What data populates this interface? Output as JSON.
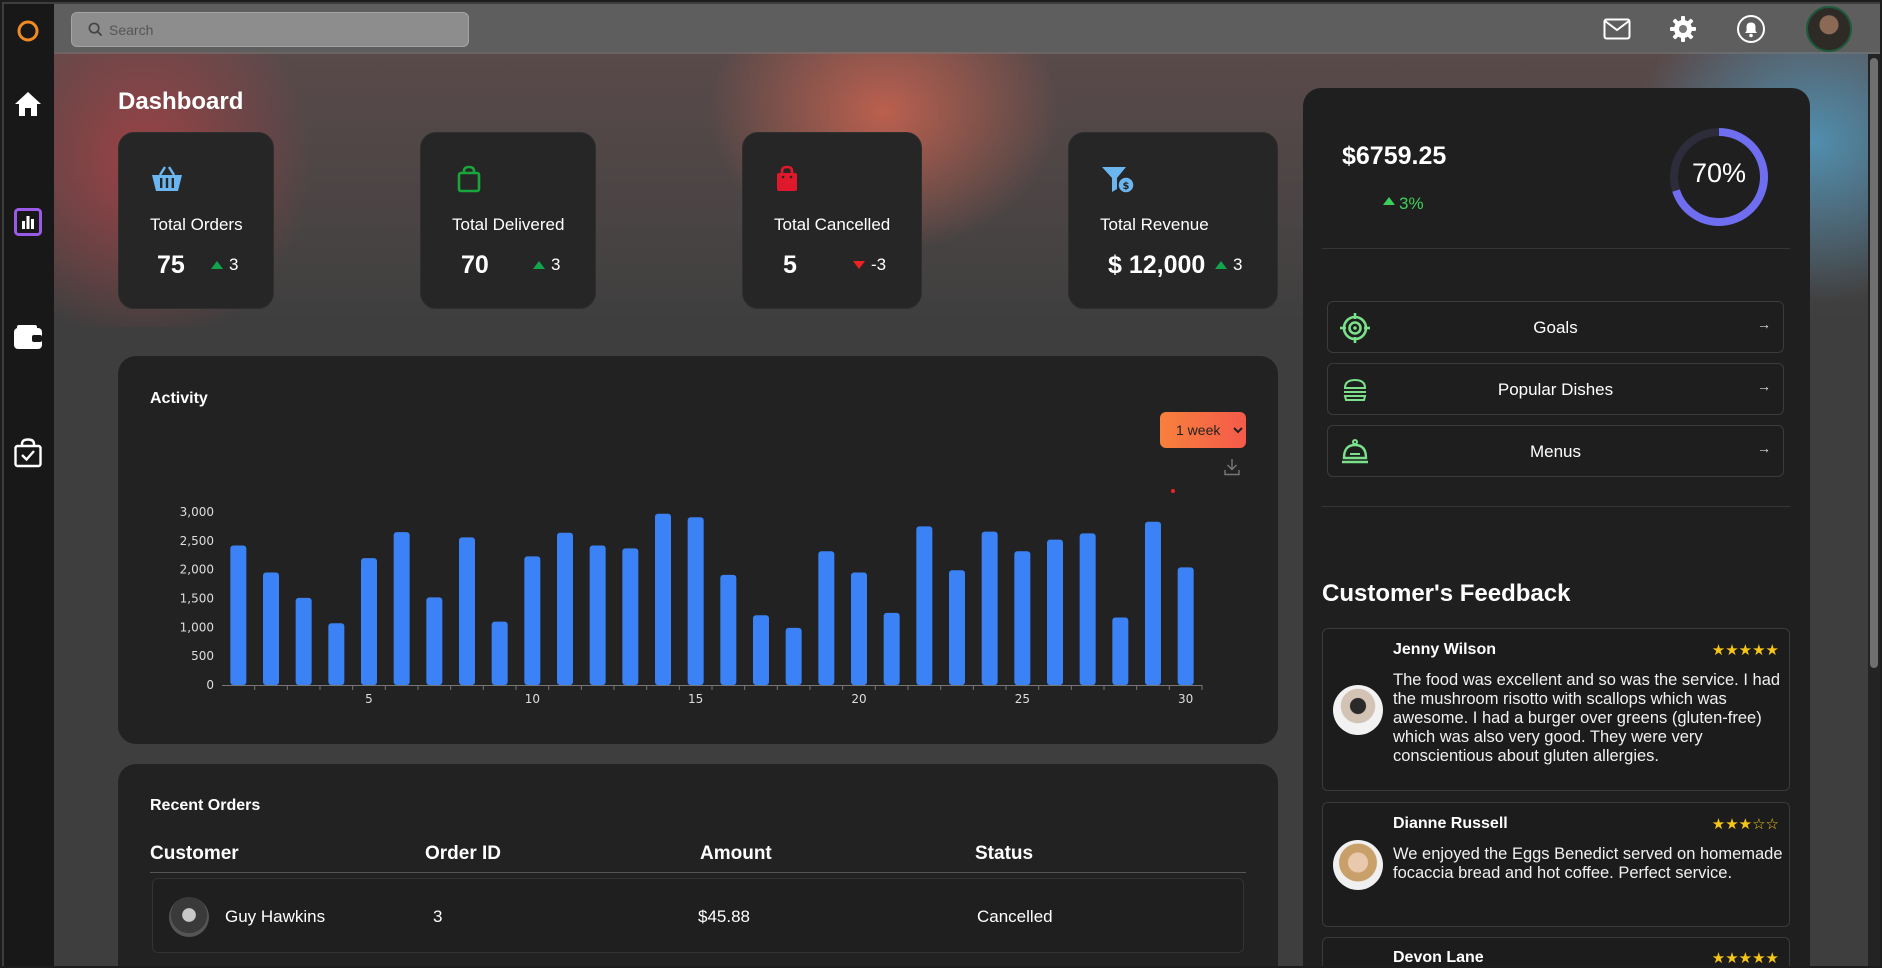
{
  "search": {
    "placeholder": "Search"
  },
  "page_title": "Dashboard",
  "stats": [
    {
      "label": "Total Orders",
      "value": "75",
      "delta": "3",
      "trend": "up",
      "icon": "basket-icon",
      "color": "#5aa9e6"
    },
    {
      "label": "Total Delivered",
      "value": "70",
      "delta": "3",
      "trend": "up",
      "icon": "shopping-bag-icon",
      "color": "#18a63c"
    },
    {
      "label": "Total Cancelled",
      "value": "5",
      "delta": "-3",
      "trend": "down",
      "icon": "shopping-bag-icon",
      "color": "#e0182b"
    },
    {
      "label": "Total Revenue",
      "value": "$ 12,000",
      "delta": "3",
      "trend": "up",
      "icon": "revenue-filter-icon",
      "color": "#5aa9e6"
    }
  ],
  "activity": {
    "title": "Activity",
    "period_options": [
      "1 week"
    ],
    "selected_period": "1 week"
  },
  "chart_data": {
    "type": "bar",
    "title": "",
    "x": [
      1,
      2,
      3,
      4,
      5,
      6,
      7,
      8,
      9,
      10,
      11,
      12,
      13,
      14,
      15,
      16,
      17,
      18,
      19,
      20,
      21,
      22,
      23,
      24,
      25,
      26,
      27,
      28,
      29,
      30
    ],
    "values": [
      2420,
      1950,
      1510,
      1070,
      2200,
      2650,
      1520,
      2560,
      1100,
      2230,
      2640,
      2420,
      2370,
      2970,
      2910,
      1910,
      1210,
      990,
      2320,
      1950,
      1250,
      2750,
      1990,
      2660,
      2320,
      2520,
      2630,
      1170,
      2830,
      2040
    ],
    "xticks": [
      "5",
      "10",
      "15",
      "20",
      "25",
      "30"
    ],
    "yticks": [
      "0",
      "500",
      "1,000",
      "1,500",
      "2,000",
      "2,500",
      "3,000"
    ],
    "ylim": [
      0,
      3000
    ],
    "color": "#3b82f6",
    "grid": false,
    "legend": "none"
  },
  "recent_orders": {
    "title": "Recent Orders",
    "columns": [
      "Customer",
      "Order ID",
      "Amount",
      "Status"
    ],
    "rows": [
      {
        "customer": "Guy Hawkins",
        "order_id": "3",
        "amount": "$45.88",
        "status": "Cancelled"
      }
    ]
  },
  "summary": {
    "amount": "$6759.25",
    "change": "3%",
    "progress_percent": 70,
    "progress_label": "70%",
    "ring_color": "#6f6ef0"
  },
  "nav_links": [
    {
      "label": "Goals",
      "icon": "target-icon"
    },
    {
      "label": "Popular Dishes",
      "icon": "burger-icon"
    },
    {
      "label": "Menus",
      "icon": "cloche-icon"
    }
  ],
  "feedback": {
    "title": "Customer's Feedback",
    "items": [
      {
        "name": "Jenny Wilson",
        "stars": "★★★★★",
        "rating": 5,
        "text": "The food was excellent and so was the service. I had the mushroom risotto with scallops which was awesome. I had a burger over greens (gluten-free) which was also very good. They were very conscientious about gluten allergies."
      },
      {
        "name": "Dianne Russell",
        "stars": "★★★☆☆",
        "rating": 3,
        "text": "We enjoyed the Eggs Benedict served on homemade focaccia bread and hot coffee. Perfect service."
      },
      {
        "name": "Devon Lane",
        "stars": "★★★★★",
        "rating": 5,
        "text": ""
      }
    ]
  }
}
